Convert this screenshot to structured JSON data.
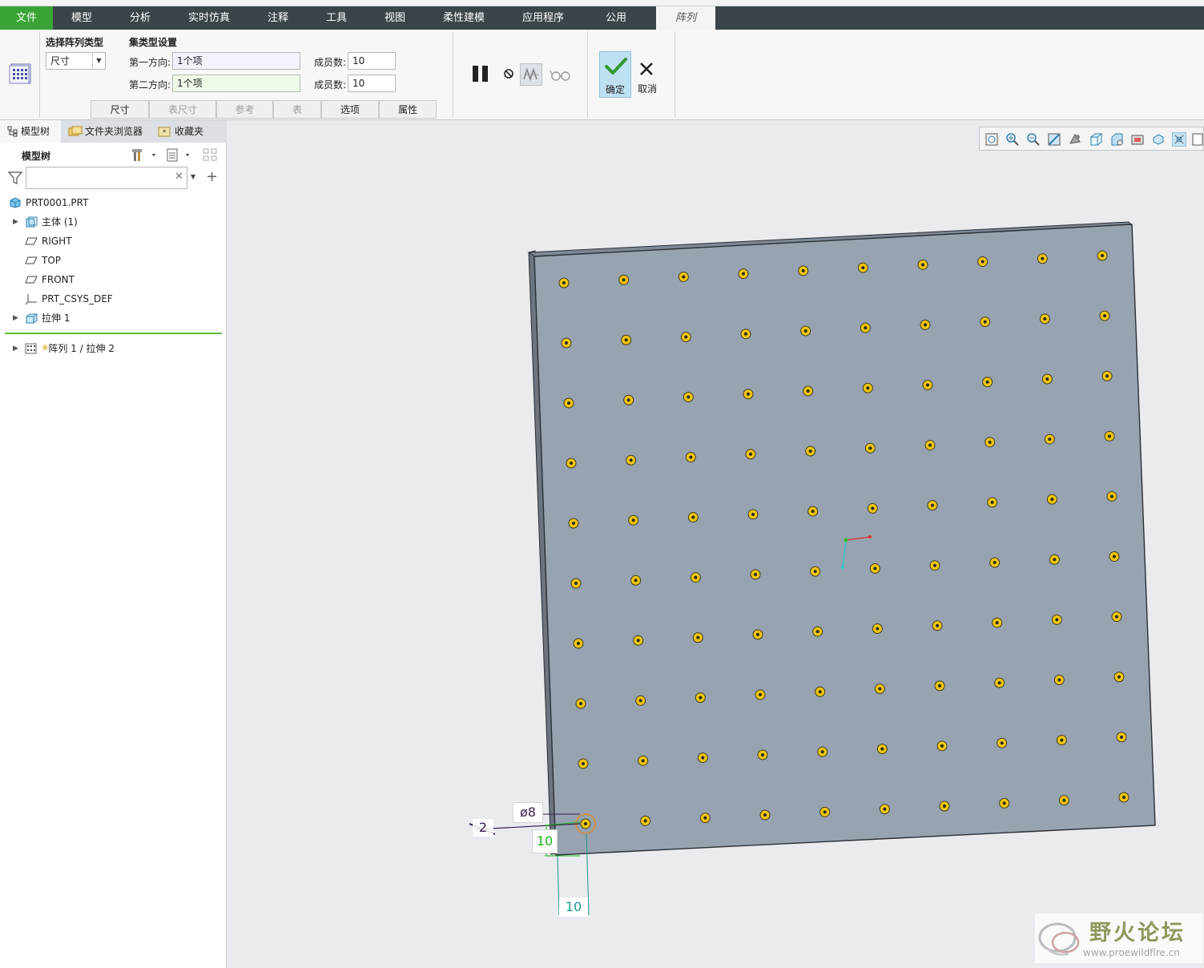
{
  "menubar": {
    "items": [
      "文件",
      "模型",
      "分析",
      "实时仿真",
      "注释",
      "工具",
      "视图",
      "柔性建模",
      "应用程序",
      "公用",
      "阵列"
    ]
  },
  "ribbon": {
    "pattern_type_title": "选择阵列类型",
    "pattern_type_value": "尺寸",
    "set_type_title": "集类型设置",
    "dir1_label": "第一方向:",
    "dir1_value": "1个项",
    "dir2_label": "第二方向:",
    "dir2_value": "1个项",
    "members1_label": "成员数:",
    "members1_value": "10",
    "members2_label": "成员数:",
    "members2_value": "10",
    "ok_label": "确定",
    "cancel_label": "取消",
    "subtabs": [
      "尺寸",
      "表尺寸",
      "参考",
      "表",
      "选项",
      "属性"
    ]
  },
  "leftpanel": {
    "tabs": [
      "模型树",
      "文件夹浏览器",
      "收藏夹"
    ],
    "tree_header": "模型树",
    "search_placeholder": "",
    "items": [
      "PRT0001.PRT",
      "主体 (1)",
      "RIGHT",
      "TOP",
      "FRONT",
      "PRT_CSYS_DEF",
      "拉伸 1",
      "阵列 1 / 拉伸 2"
    ],
    "pattern_marker": "※"
  },
  "viewport": {
    "dim_diameter": "ø8",
    "dim_left": "2",
    "dim_vertical": "10",
    "dim_horizontal": "10",
    "pattern_rows": 10,
    "pattern_cols": 10
  },
  "watermark": {
    "text": "野火论坛",
    "url": "www.proewildfire.cn"
  },
  "colors": {
    "menubar": "#3b4449",
    "file_menu": "#3aa335",
    "plate": "#97a3b1",
    "hole_fill": "#f1c411",
    "ok_button": "#bfe0f3",
    "dim_purple": "#3a1f4f",
    "dim_green": "#19b519",
    "dim_teal": "#1a9a8a"
  }
}
